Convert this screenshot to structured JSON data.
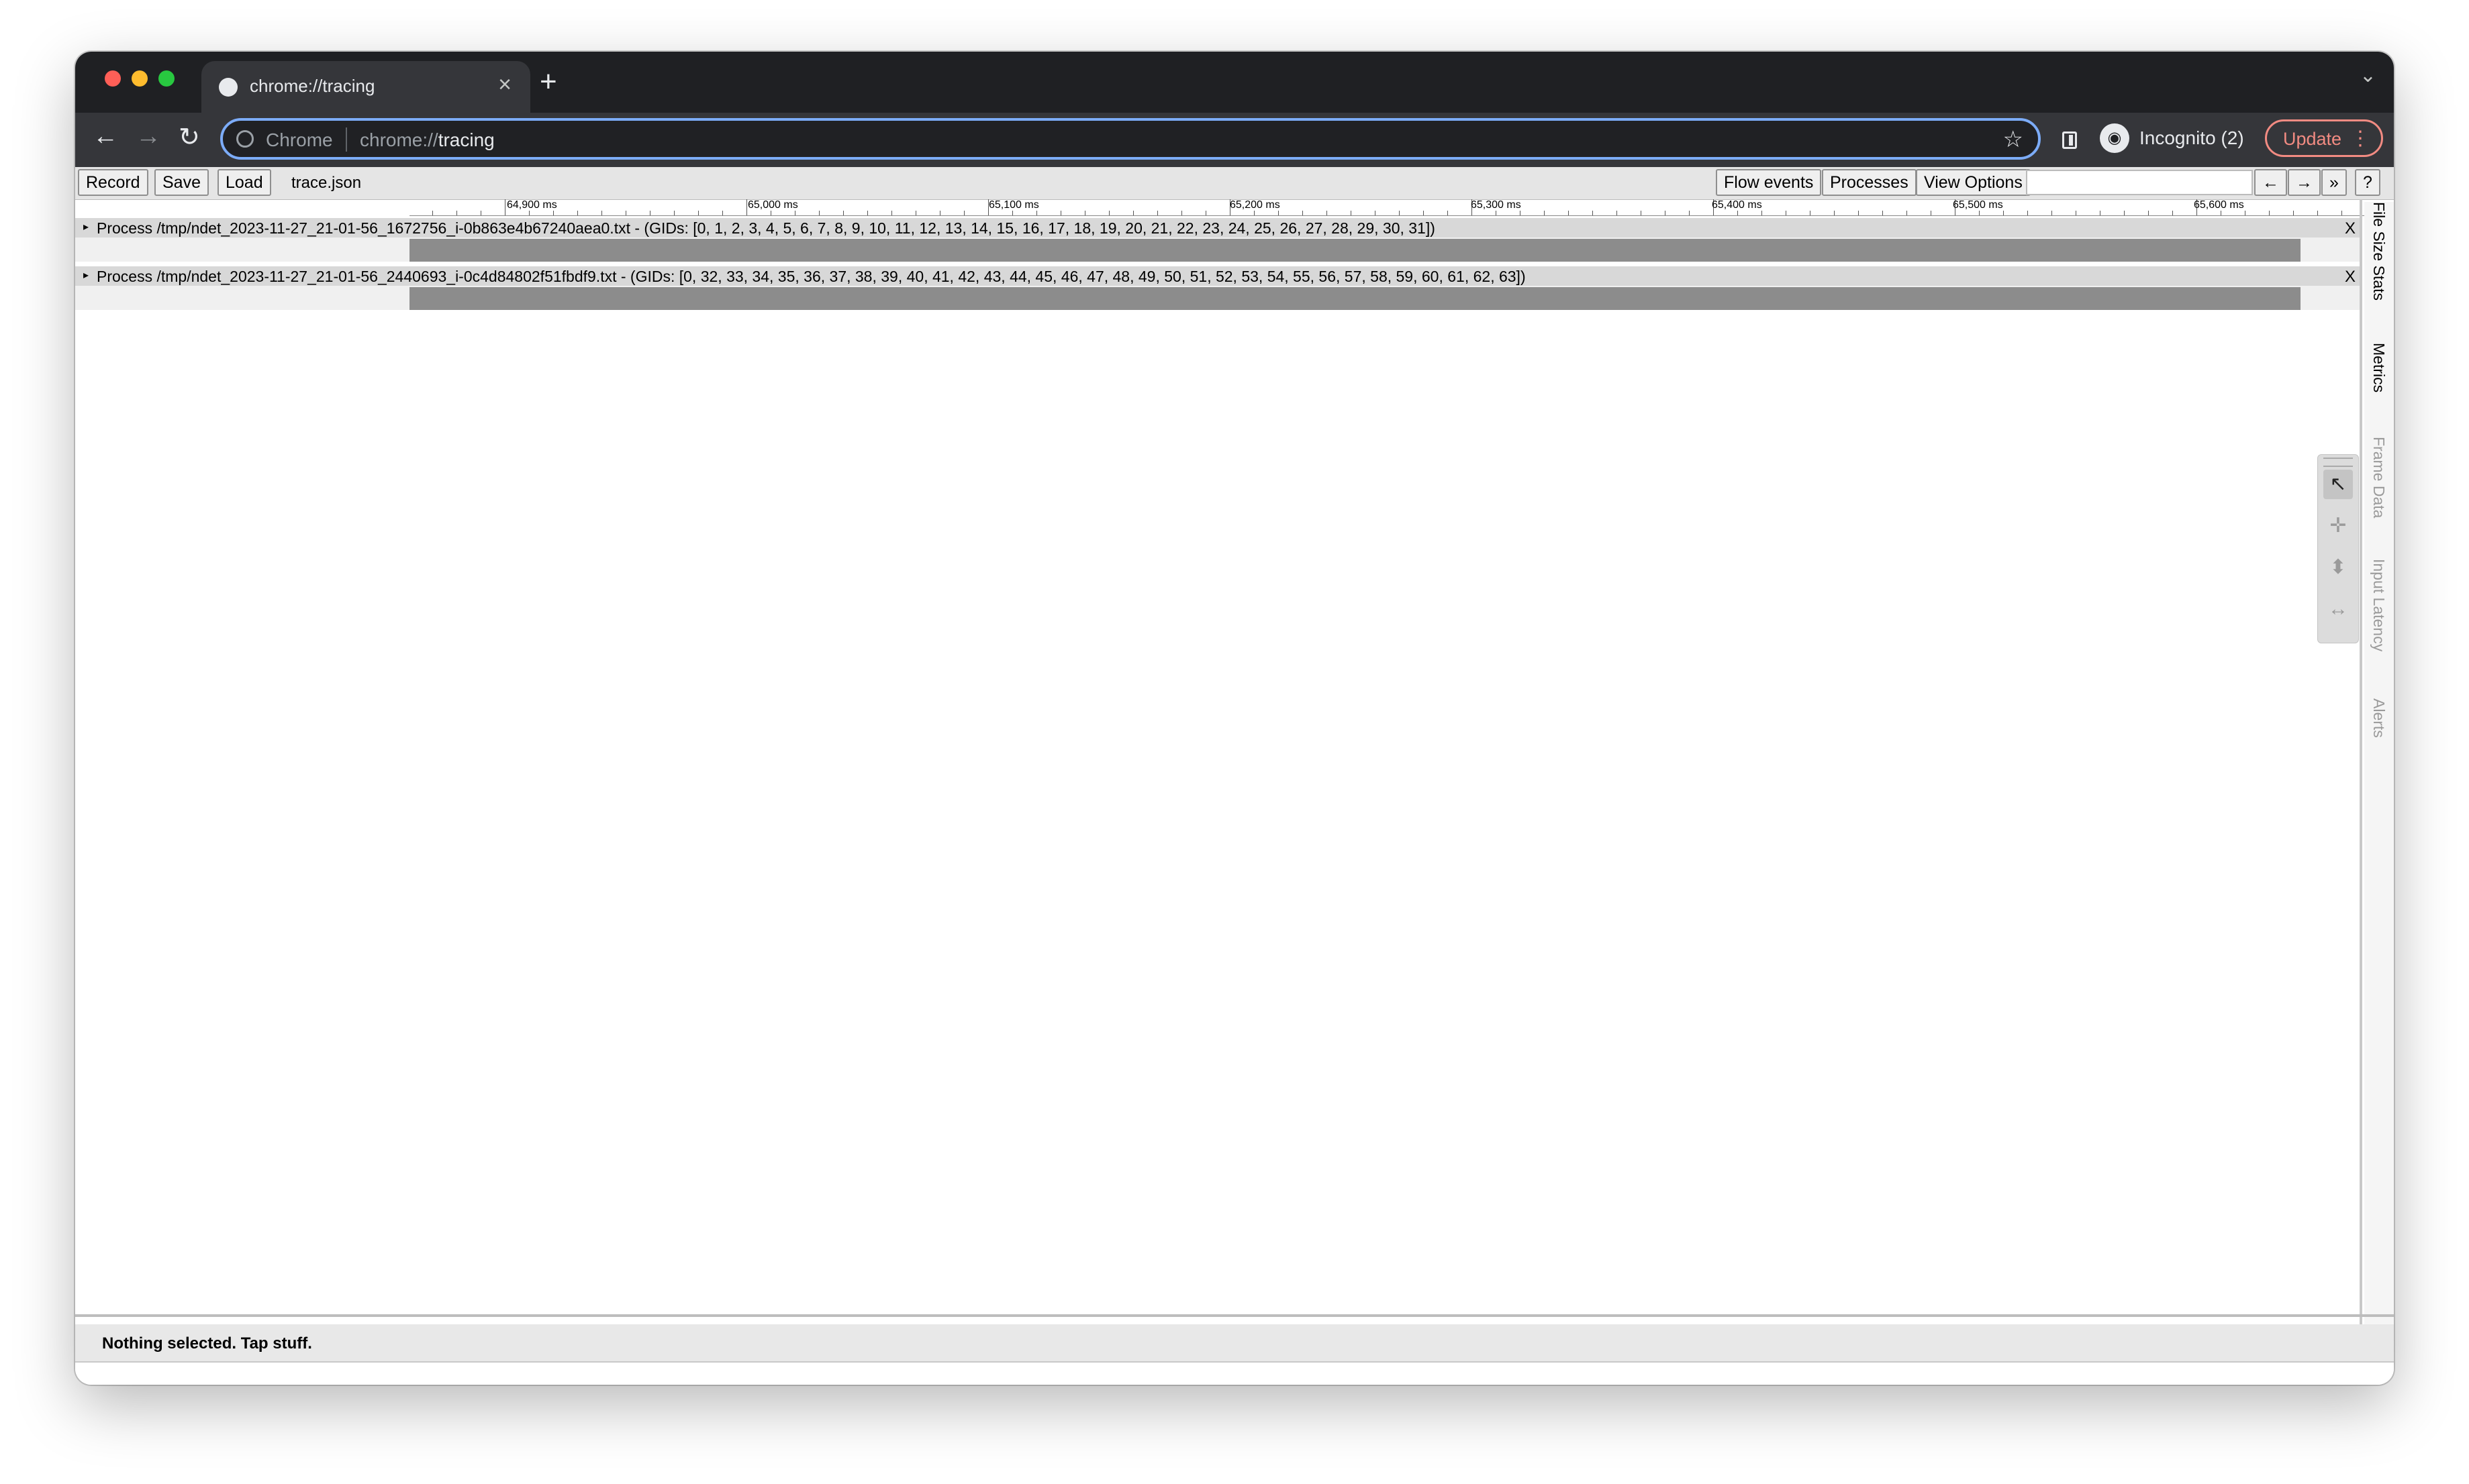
{
  "browser": {
    "tab_title": "chrome://tracing",
    "new_tab": "+",
    "tab_close": "×",
    "omnibox": {
      "chip": "Chrome",
      "url_prefix": "chrome://",
      "url_host": "tracing"
    },
    "profile_label": "Incognito (2)",
    "update_label": "Update",
    "buttons": {
      "back": "←",
      "forward": "→",
      "reload": "↻",
      "star": "☆",
      "tab_menu": "⌄",
      "menu": "⋮"
    }
  },
  "tracing_toolbar": {
    "record": "Record",
    "save": "Save",
    "load": "Load",
    "title": "trace.json",
    "flow_events": "Flow events",
    "processes": "Processes",
    "view_options": "View Options",
    "nav_left": "←",
    "nav_right": "→",
    "expand": "»",
    "help": "?"
  },
  "ruler": {
    "labels": [
      "64,900 ms",
      "65,000 ms",
      "65,100 ms",
      "65,200 ms",
      "65,300 ms",
      "65,400 ms",
      "65,500 ms",
      "65,600 ms"
    ]
  },
  "processes": [
    {
      "label": "Process /tmp/ndet_2023-11-27_21-01-56_1672756_i-0b863e4b67240aea0.txt - (GIDs: [0, 1, 2, 3, 4, 5, 6, 7, 8, 9, 10, 11, 12, 13, 14, 15, 16, 17, 18, 19, 20, 21, 22, 23, 24, 25, 26, 27, 28, 29, 30, 31])",
      "close": "X"
    },
    {
      "label": "Process /tmp/ndet_2023-11-27_21-01-56_2440693_i-0c4d84802f51fbdf9.txt - (GIDs: [0, 32, 33, 34, 35, 36, 37, 38, 39, 40, 41, 42, 43, 44, 45, 46, 47, 48, 49, 50, 51, 52, 53, 54, 55, 56, 57, 58, 59, 60, 61, 62, 63])",
      "close": "X"
    }
  ],
  "side_tabs": [
    "File Size Stats",
    "Metrics",
    "Frame Data",
    "Input Latency",
    "Alerts"
  ],
  "mouse_tools": {
    "select": "↖",
    "pan": "✛",
    "zoom": "⬍",
    "timing": "↔"
  },
  "status": "Nothing selected. Tap stuff.",
  "colors": {
    "omnibox_focus": "#7cacf8",
    "update_accent": "#f28b82",
    "slice_gray": "#8c8c8c"
  }
}
